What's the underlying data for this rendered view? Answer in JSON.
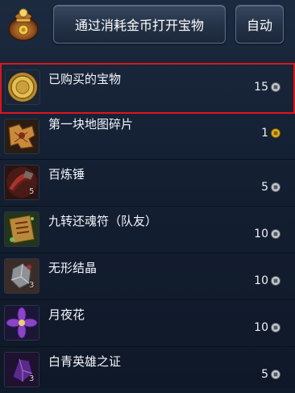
{
  "header": {
    "open_button_label": "通过消耗金币打开宝物",
    "auto_button_label": "自动"
  },
  "items": [
    {
      "name": "已购买的宝物",
      "price": "15",
      "currency": "silver",
      "qty": "",
      "selected": true
    },
    {
      "name": "第一块地图碎片",
      "price": "1",
      "currency": "gold",
      "qty": "",
      "selected": false
    },
    {
      "name": "百炼锤",
      "price": "5",
      "currency": "silver",
      "qty": "5",
      "selected": false
    },
    {
      "name": "九转还魂符（队友）",
      "price": "10",
      "currency": "silver",
      "qty": "",
      "selected": false
    },
    {
      "name": "无形结晶",
      "price": "10",
      "currency": "silver",
      "qty": "3",
      "selected": false
    },
    {
      "name": "月夜花",
      "price": "10",
      "currency": "silver",
      "qty": "",
      "selected": false
    },
    {
      "name": "白青英雄之证",
      "price": "5",
      "currency": "silver",
      "qty": "3",
      "selected": false
    }
  ],
  "colors": {
    "selection_border": "#e0141c",
    "silver_coin": "#c9ccd2",
    "gold_coin": "#e8b21a"
  },
  "icons": [
    "treasure-bag-icon",
    "gold-coin-icon",
    "map-piece-icon",
    "hammer-icon",
    "talisman-icon",
    "crystal-icon",
    "moon-flower-icon",
    "hero-token-icon",
    "silver-coin-icon"
  ]
}
